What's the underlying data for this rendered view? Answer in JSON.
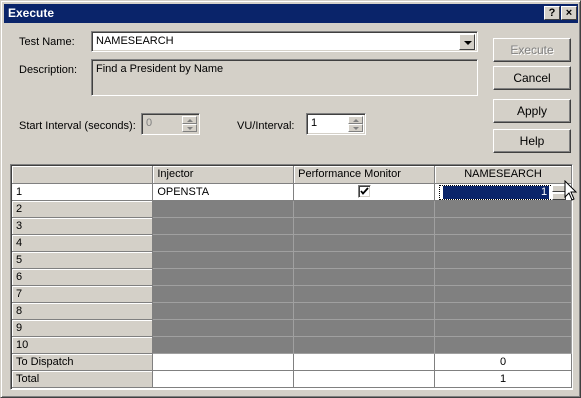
{
  "window": {
    "title": "Execute"
  },
  "title_buttons": {
    "help": "?",
    "close": "×"
  },
  "form": {
    "test_name_label": "Test Name:",
    "test_name_value": "NAMESEARCH",
    "description_label": "Description:",
    "description_value": "Find a President by Name",
    "start_interval_label": "Start Interval (seconds):",
    "start_interval_value": "0",
    "vu_interval_label": "VU/Interval:",
    "vu_interval_value": "1"
  },
  "buttons": {
    "execute": "Execute",
    "cancel": "Cancel",
    "apply": "Apply",
    "help": "Help"
  },
  "grid": {
    "columns": [
      "",
      "Injector",
      "Performance Monitor",
      "NAMESEARCH"
    ],
    "rows": [
      {
        "label": "1",
        "injector": "OPENSTA",
        "monitor_checked": true,
        "value": "1"
      },
      {
        "label": "2"
      },
      {
        "label": "3"
      },
      {
        "label": "4"
      },
      {
        "label": "5"
      },
      {
        "label": "6"
      },
      {
        "label": "7"
      },
      {
        "label": "8"
      },
      {
        "label": "9"
      },
      {
        "label": "10"
      }
    ],
    "to_dispatch_label": "To Dispatch",
    "to_dispatch_value": "0",
    "total_label": "Total",
    "total_value": "1"
  },
  "colors": {
    "titlebar": "#0a246a",
    "face": "#d4d0c8",
    "inactive_cells": "#808080"
  }
}
